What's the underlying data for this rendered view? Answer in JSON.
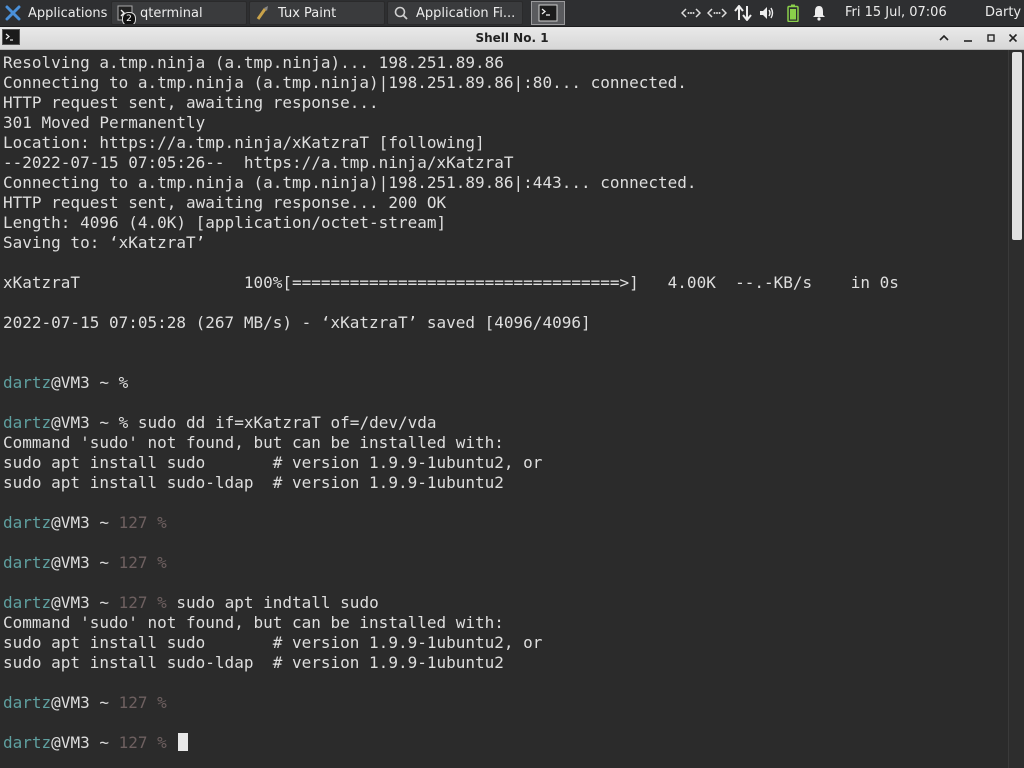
{
  "panel": {
    "applications_label": "Applications",
    "taskbar": [
      {
        "label": "qterminal",
        "badge": "2"
      },
      {
        "label": "Tux Paint"
      },
      {
        "label": "Application Fi..."
      }
    ],
    "clock": "Fri 15 Jul, 07:06",
    "user": "Darty uwu"
  },
  "window": {
    "title": "Shell No. 1"
  },
  "terminal": {
    "lines": [
      "Resolving a.tmp.ninja (a.tmp.ninja)... 198.251.89.86",
      "Connecting to a.tmp.ninja (a.tmp.ninja)|198.251.89.86|:80... connected.",
      "HTTP request sent, awaiting response...",
      "301 Moved Permanently",
      "Location: https://a.tmp.ninja/xKatzraT [following]",
      "--2022-07-15 07:05:26--  https://a.tmp.ninja/xKatzraT",
      "Connecting to a.tmp.ninja (a.tmp.ninja)|198.251.89.86|:443... connected.",
      "HTTP request sent, awaiting response... 200 OK",
      "Length: 4096 (4.0K) [application/octet-stream]",
      "Saving to: ‘xKatzraT’",
      "",
      "xKatzraT                 100%[==================================>]   4.00K  --.-KB/s    in 0s",
      "",
      "2022-07-15 07:05:28 (267 MB/s) - ‘xKatzraT’ saved [4096/4096]",
      "",
      "",
      {
        "prompt": {
          "user": "dartz",
          "host": "@VM3 ~ ",
          "status": "",
          "sym": "%"
        },
        "cmd": ""
      },
      "",
      {
        "prompt": {
          "user": "dartz",
          "host": "@VM3 ~ ",
          "status": "",
          "sym": "%"
        },
        "cmd": " sudo dd if=xKatzraT of=/dev/vda"
      },
      "Command 'sudo' not found, but can be installed with:",
      "sudo apt install sudo       # version 1.9.9-1ubuntu2, or",
      "sudo apt install sudo-ldap  # version 1.9.9-1ubuntu2",
      "",
      {
        "prompt": {
          "user": "dartz",
          "host": "@VM3 ~ ",
          "status": "127 ",
          "sym": "%"
        },
        "cmd": ""
      },
      "",
      {
        "prompt": {
          "user": "dartz",
          "host": "@VM3 ~ ",
          "status": "127 ",
          "sym": "%"
        },
        "cmd": ""
      },
      "",
      {
        "prompt": {
          "user": "dartz",
          "host": "@VM3 ~ ",
          "status": "127 ",
          "sym": "%"
        },
        "cmd": " sudo apt indtall sudo"
      },
      "Command 'sudo' not found, but can be installed with:",
      "sudo apt install sudo       # version 1.9.9-1ubuntu2, or",
      "sudo apt install sudo-ldap  # version 1.9.9-1ubuntu2",
      "",
      {
        "prompt": {
          "user": "dartz",
          "host": "@VM3 ~ ",
          "status": "127 ",
          "sym": "%"
        },
        "cmd": ""
      },
      "",
      {
        "prompt": {
          "user": "dartz",
          "host": "@VM3 ~ ",
          "status": "127 ",
          "sym": "%"
        },
        "cmd": " ",
        "cursor": true
      }
    ]
  },
  "colors": {
    "prompt_user": "#5fa0a0",
    "exit_status": "#6e6060",
    "terminal_bg": "#2b2b2b",
    "terminal_fg": "#dedede"
  }
}
